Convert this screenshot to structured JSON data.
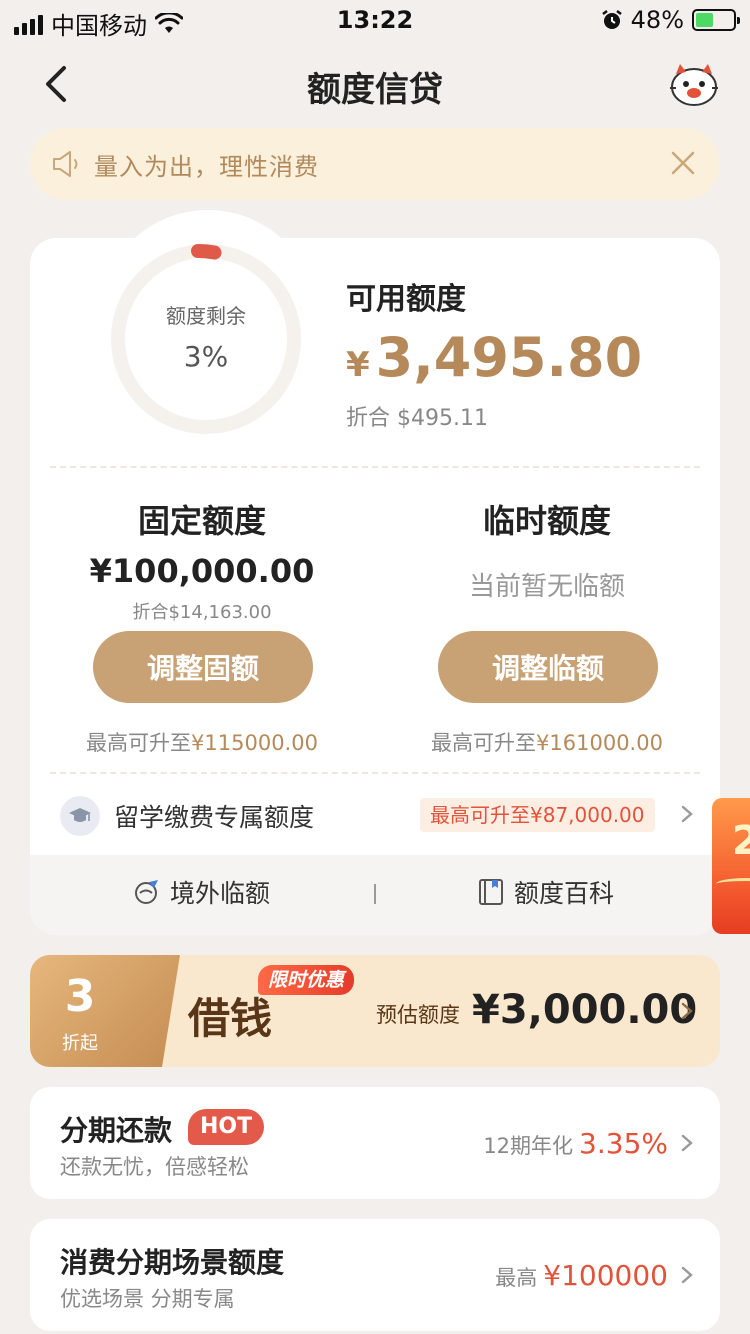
{
  "status_bar": {
    "carrier": "中国移动",
    "time": "13:22",
    "battery_pct": "48%",
    "battery_level": 0.48,
    "icons": [
      "signal-icon",
      "wifi-icon",
      "alarm-icon",
      "battery-icon"
    ]
  },
  "nav": {
    "title": "额度信贷",
    "back_icon": "back-arrow-icon",
    "mascot_icon": "mascot-avatar-icon"
  },
  "notice": {
    "text": "量入为出，理性消费",
    "icon": "speaker-icon",
    "close_icon": "close-icon"
  },
  "quota": {
    "ring_label": "额度剩余",
    "ring_value": "3%",
    "ring_fraction": 0.03,
    "available_label": "可用额度",
    "available_currency": "¥",
    "available_amount": "3,495.80",
    "available_converted": "折合  $495.11"
  },
  "fixed": {
    "title": "固定额度",
    "amount": "¥100,000.00",
    "converted": "折合$14,163.00",
    "button": "调整固额",
    "max_prefix": "最高可升至",
    "max_value": "¥115000.00"
  },
  "temp": {
    "title": "临时额度",
    "empty": "当前暂无临额",
    "button": "调整临额",
    "max_prefix": "最高可升至",
    "max_value": "¥161000.00"
  },
  "study": {
    "label": "留学缴费专属额度",
    "badge": "最高可升至¥87,000.00",
    "icon": "graduation-cap-icon"
  },
  "bottom_links": [
    {
      "label": "境外临额",
      "icon": "globe-plane-icon"
    },
    {
      "label": "额度百科",
      "icon": "book-icon"
    }
  ],
  "side_float": {
    "text": "2"
  },
  "loan": {
    "discount_num": "3",
    "discount_unit": "折起",
    "title": "借钱",
    "tag": "限时优惠",
    "est_label": "预估额度",
    "est_value": "¥3,000.00"
  },
  "installment": {
    "title": "分期还款",
    "hot": "HOT",
    "sub": "还款无忧，倍感轻松",
    "right_label": "12期年化",
    "right_value": "3.35%"
  },
  "scene": {
    "title": "消费分期场景额度",
    "sub": "优选场景 分期专属",
    "right_label": "最高",
    "right_value": "¥100000"
  },
  "colors": {
    "accent_gold": "#b5895a",
    "button_gold": "#c8a174",
    "red": "#e2533a",
    "notice_bg": "#fbf0dc"
  }
}
